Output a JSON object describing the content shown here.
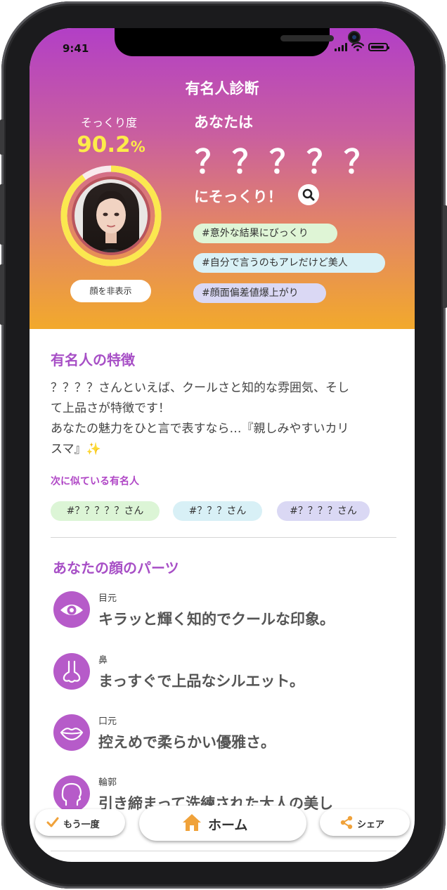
{
  "status_bar": {
    "time": "9:41"
  },
  "header": {
    "title": "有名人診断"
  },
  "similarity": {
    "label": "そっくり度",
    "value": "90.2",
    "unit": "%",
    "ratio": 0.902
  },
  "photo_toggle_label": "顔を非表示",
  "result": {
    "prefix": "あなたは",
    "celebrity_name": "？？？？？",
    "suffix": "にそっくり！"
  },
  "hashtags": [
    {
      "text": "#意外な結果にびっくり",
      "color": "#dff5d6"
    },
    {
      "text": "#自分で言うのもアレだけど美人",
      "color": "#d9f1f6"
    },
    {
      "text": "#顔面偏差値爆上がり",
      "color": "#dad8f4"
    }
  ],
  "features": {
    "title": "有名人の特徴",
    "description_lines": [
      "？？？？さんといえば、クールさと知的な雰囲気、そし",
      "て上品さが特徴です！",
      "あなたの魅力をひと言で表すなら…『親しみやすいカリ",
      "スマ』✨"
    ],
    "similar_label": "次に似ている有名人",
    "similar_celebs": [
      {
        "text": "#？？？？？さん",
        "color": "#dcf5d6"
      },
      {
        "text": "#？？？さん",
        "color": "#d8f0f6"
      },
      {
        "text": "#？？？？さん",
        "color": "#dad8f4"
      }
    ]
  },
  "face_parts": {
    "title": "あなたの顔のパーツ",
    "items": [
      {
        "label": "目元",
        "text": "キラッと輝く知的でクールな印象。",
        "icon": "eye-icon"
      },
      {
        "label": "鼻",
        "text": "まっすぐで上品なシルエット。",
        "icon": "nose-icon"
      },
      {
        "label": "口元",
        "text": "控えめで柔らかい優雅さ。",
        "icon": "lips-icon"
      },
      {
        "label": "輪郭",
        "text": "引き締まって洗練された大人の美し",
        "icon": "face-outline-icon"
      }
    ]
  },
  "bottom_bar": {
    "retry_label": "もう一度",
    "home_label": "ホーム",
    "share_label": "シェア"
  },
  "colors": {
    "accent_purple": "#a74fc6",
    "ring_yellow": "#fbe84f",
    "home_orange": "#f0a23a"
  }
}
